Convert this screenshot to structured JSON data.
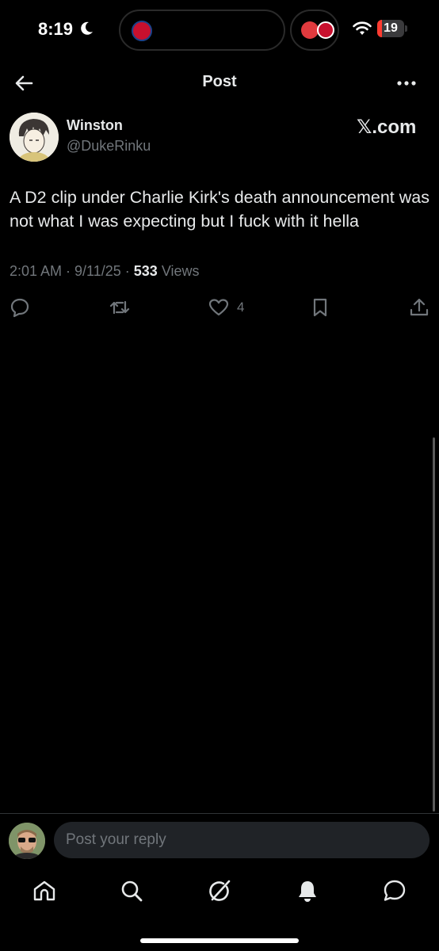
{
  "status_bar": {
    "time": "8:19",
    "battery_level": "19",
    "battery_fraction": 0.19,
    "battery_color": "#ff3b30"
  },
  "header": {
    "title": "Post"
  },
  "post": {
    "author_name": "Winston",
    "author_handle": "@DukeRinku",
    "watermark": ".com",
    "text": "A D2 clip under Charlie Kirk's death announcement was not what I was expecting but I fuck with it hella",
    "time": "2:01 AM",
    "date": "9/11/25",
    "separator": " · ",
    "views_count": "533",
    "views_label": "Views",
    "like_count": "4"
  },
  "reply": {
    "placeholder": "Post your reply"
  },
  "tabs": [
    {
      "icon": "home-icon"
    },
    {
      "icon": "search-icon"
    },
    {
      "icon": "grok-icon"
    },
    {
      "icon": "notifications-icon"
    },
    {
      "icon": "messages-icon"
    }
  ],
  "colors": {
    "background": "#000000",
    "text": "#e7e9ea",
    "secondary": "#71767b",
    "input_bg": "#202327"
  }
}
